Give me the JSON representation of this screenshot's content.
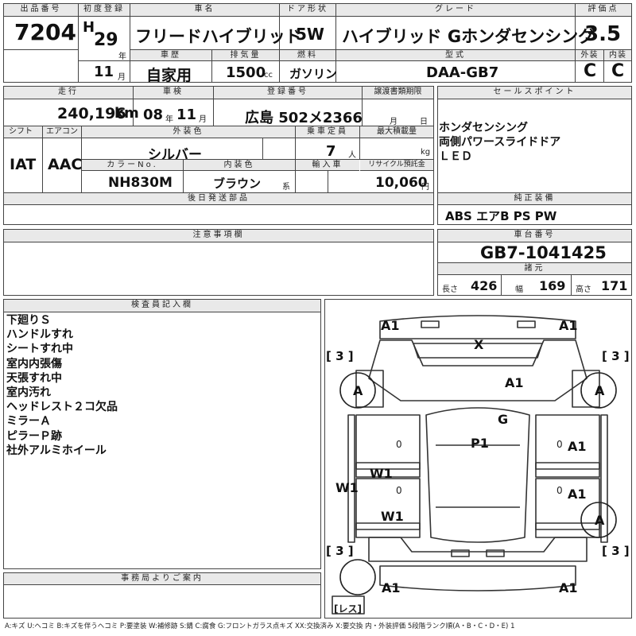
{
  "header": {
    "lot_label": "出品番号",
    "lot_no": "7204",
    "first_reg_label": "初度登録",
    "era": "H",
    "year": "29",
    "year_unit": "年",
    "car_name_label": "車名",
    "car_name": "フリードハイブリッド",
    "door_label": "ドア形状",
    "door": "5W",
    "grade_label": "グレード",
    "grade": "ハイブリッド Gホンダセンシング",
    "score_label": "評価点",
    "score": "3.5",
    "month": "11",
    "month_unit": "月",
    "history_label": "車歴",
    "history": "自家用",
    "displacement_label": "排気量",
    "displacement": "1500",
    "cc_unit": "cc",
    "fuel_label": "燃料",
    "fuel": "ガソリン",
    "model_label": "型式",
    "model": "DAA-GB7",
    "ext_label": "外装",
    "ext": "C",
    "int_label": "内装",
    "int": "C"
  },
  "spec": {
    "mileage_label": "走行",
    "mileage": "240,196",
    "mileage_unit": "km",
    "inspection_label": "車検",
    "insp_year": "08",
    "insp_year_unit": "年",
    "insp_month": "11",
    "insp_month_unit": "月",
    "reg_label": "登録番号",
    "reg_no": "広島 502メ2366",
    "transfer_label": "譲渡書類期限",
    "transfer_month_unit": "月",
    "transfer_day_unit": "日",
    "shift_label": "シフト",
    "shift": "IAT",
    "ac_label": "エアコン",
    "ac": "AAC",
    "color_label": "外装色",
    "color": "シルバー",
    "capacity_label": "乗車定員",
    "capacity": "7",
    "capacity_unit": "人",
    "load_label": "最大積載量",
    "load_unit": "kg",
    "color_no_label": "カラーNo.",
    "color_no": "NH830M",
    "interior_label": "内装色",
    "interior": "ブラウン",
    "interior_suffix": "系",
    "import_label": "輸入車",
    "recycle_label": "リサイクル預託金",
    "recycle": "10,060",
    "recycle_unit": "円",
    "later_label": "後日発送部品"
  },
  "sales_label": "セールスポイント",
  "sales_points": [
    "ホンダセンシング",
    "両側パワースライドドア",
    "ＬＥＤ"
  ],
  "equip_label": "純正装備",
  "equipment": "ABS エアB PS PW",
  "notes_label": "注意事項欄",
  "chassis_label": "車台番号",
  "chassis": "GB7-1041425",
  "dims_label": "諸元",
  "length_label": "長さ",
  "length": "426",
  "width_label": "幅",
  "width": "169",
  "height_label": "高さ",
  "height": "171",
  "inspector_label": "検査員記入欄",
  "inspector_notes": [
    "下廻りＳ",
    "ハンドルすれ",
    "シートすれ中",
    "室内内張傷",
    "天張すれ中",
    "室内汚れ",
    "ヘッドレスト２コ欠品",
    "ミラーＡ",
    "ピラーＰ跡",
    "社外アルミホイール"
  ],
  "office_label": "事務局よりご案内",
  "legend": "A:キズ U:ヘコミ B:キズを伴うヘコミ P:要塗装 W:補修跡 S:錆 C:腐食 G:フロントガラス点キズ XX:交換済み X:要交換 内・外装評価 5段階ランク順(A・B・C・D・E) 1",
  "diagram": {
    "marks": {
      "front_left": "A1",
      "front_right": "A1",
      "windshield": "X",
      "hood": "A1",
      "roof_front": "G",
      "roof": "P1",
      "wheel_fl": "A",
      "wheel_fr": "A",
      "wheel_rr": "A",
      "door_fr": "A1",
      "door_rr": "A1",
      "door_fl": "W1",
      "door_rl": "W1",
      "sill_l": "W1",
      "rear_left": "A1",
      "rear_right": "A1",
      "zero_a": "0",
      "zero_b": "0",
      "zero_c": "0",
      "zero_d": "0"
    },
    "tires": {
      "fl": "[ 3 ]",
      "fr": "[ 3 ]",
      "rl": "[ 3 ]",
      "rr": "[ 3 ]"
    },
    "spare": "[レス]"
  }
}
